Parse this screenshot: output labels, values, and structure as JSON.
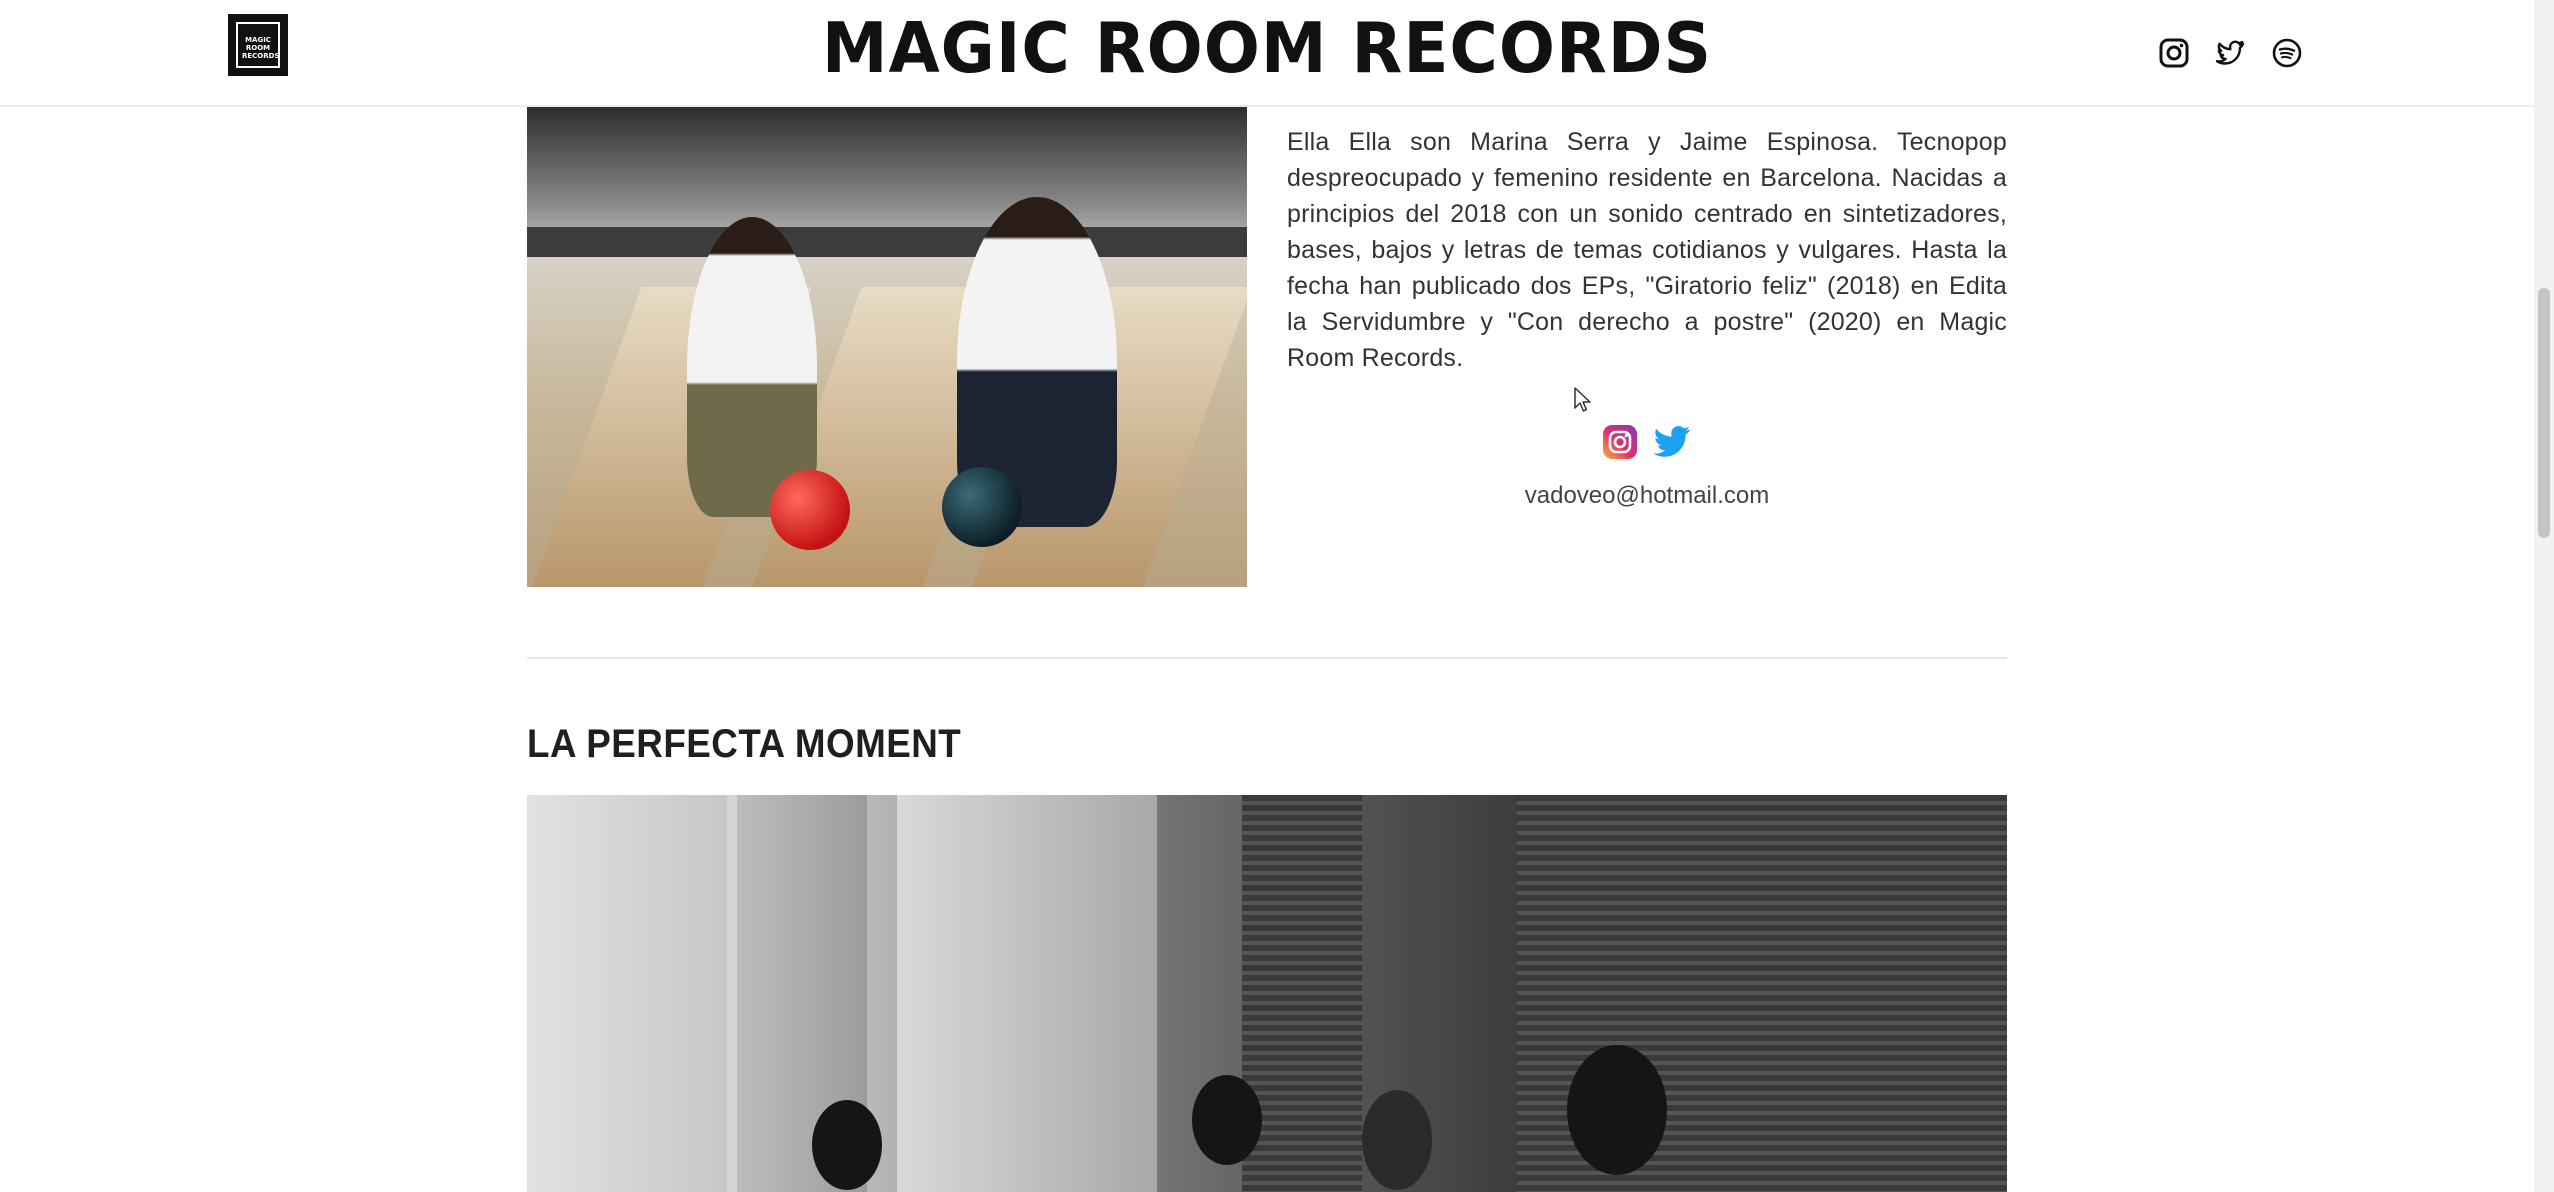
{
  "header": {
    "logo_text": "MAGIC ROOM RECORDS",
    "title": "MAGIC ROOM RECORDS",
    "social": [
      {
        "name": "instagram",
        "icon": "instagram-icon"
      },
      {
        "name": "twitter",
        "icon": "twitter-icon"
      },
      {
        "name": "spotify",
        "icon": "spotify-icon"
      }
    ]
  },
  "artist1": {
    "bio": "Ella Ella son Marina Serra y Jaime Espinosa. Tecnopop despreocupado y femenino residente en Barcelona. Nacidas a principios del 2018 con un sonido centrado en sintetizadores, bases, bajos y letras de temas cotidianos y vulgares. Hasta la fecha han publicado dos EPs, \"Giratorio feliz\" (2018) en Edita la Servidumbre y \"Con derecho a postre\" (2020) en Magic Room Records.",
    "links": [
      {
        "icon": "instagram-icon",
        "color": "#d6249f"
      },
      {
        "icon": "twitter-icon",
        "color": "#1da1f2"
      }
    ],
    "email": "vadoveo@hotmail.com"
  },
  "artist2": {
    "title": "LA PERFECTA MOMENT"
  }
}
